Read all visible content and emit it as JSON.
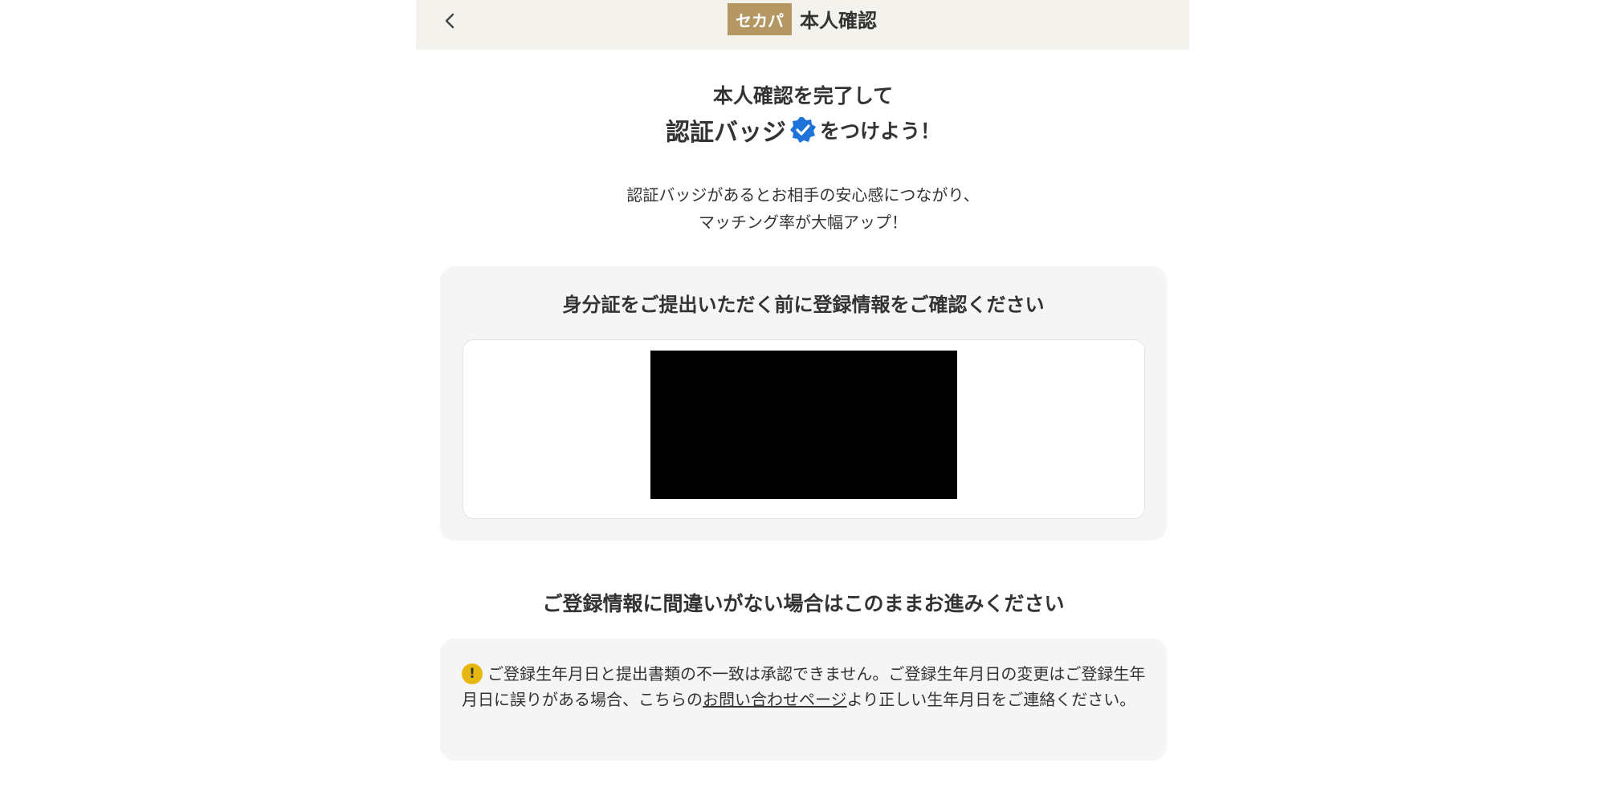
{
  "header": {
    "brand": "セカパ",
    "title": "本人確認",
    "back_icon": "chevron-left-icon"
  },
  "hero": {
    "line1": "本人確認を完了して",
    "badge_text": "認証バッジ",
    "badge_icon": "verified-badge-icon",
    "suffix": "をつけよう！",
    "description_line1": "認証バッジがあるとお相手の安心感につながり、",
    "description_line2": "マッチング率が大幅アップ！"
  },
  "confirm_card": {
    "title": "身分証をご提出いただく前に登録情報をご確認ください"
  },
  "proceed_text": "ご登録情報に間違いがない場合はこのままお進みください",
  "notice": {
    "icon": "exclamation-icon",
    "text_before": "ご登録生年月日と提出書類の不一致は承認できません。ご登録生年月日の変更はご登録生年月日に誤りがある場合、こちらの",
    "link_text": "お問い合わせページ",
    "text_after": "より正しい生年月日をご連絡ください。"
  },
  "colors": {
    "header_bg": "#f4f2ec",
    "brand_gold": "#b49763",
    "verified_blue": "#1e73d9",
    "warning_yellow": "#e6b80f",
    "card_bg": "#f5f5f5"
  }
}
